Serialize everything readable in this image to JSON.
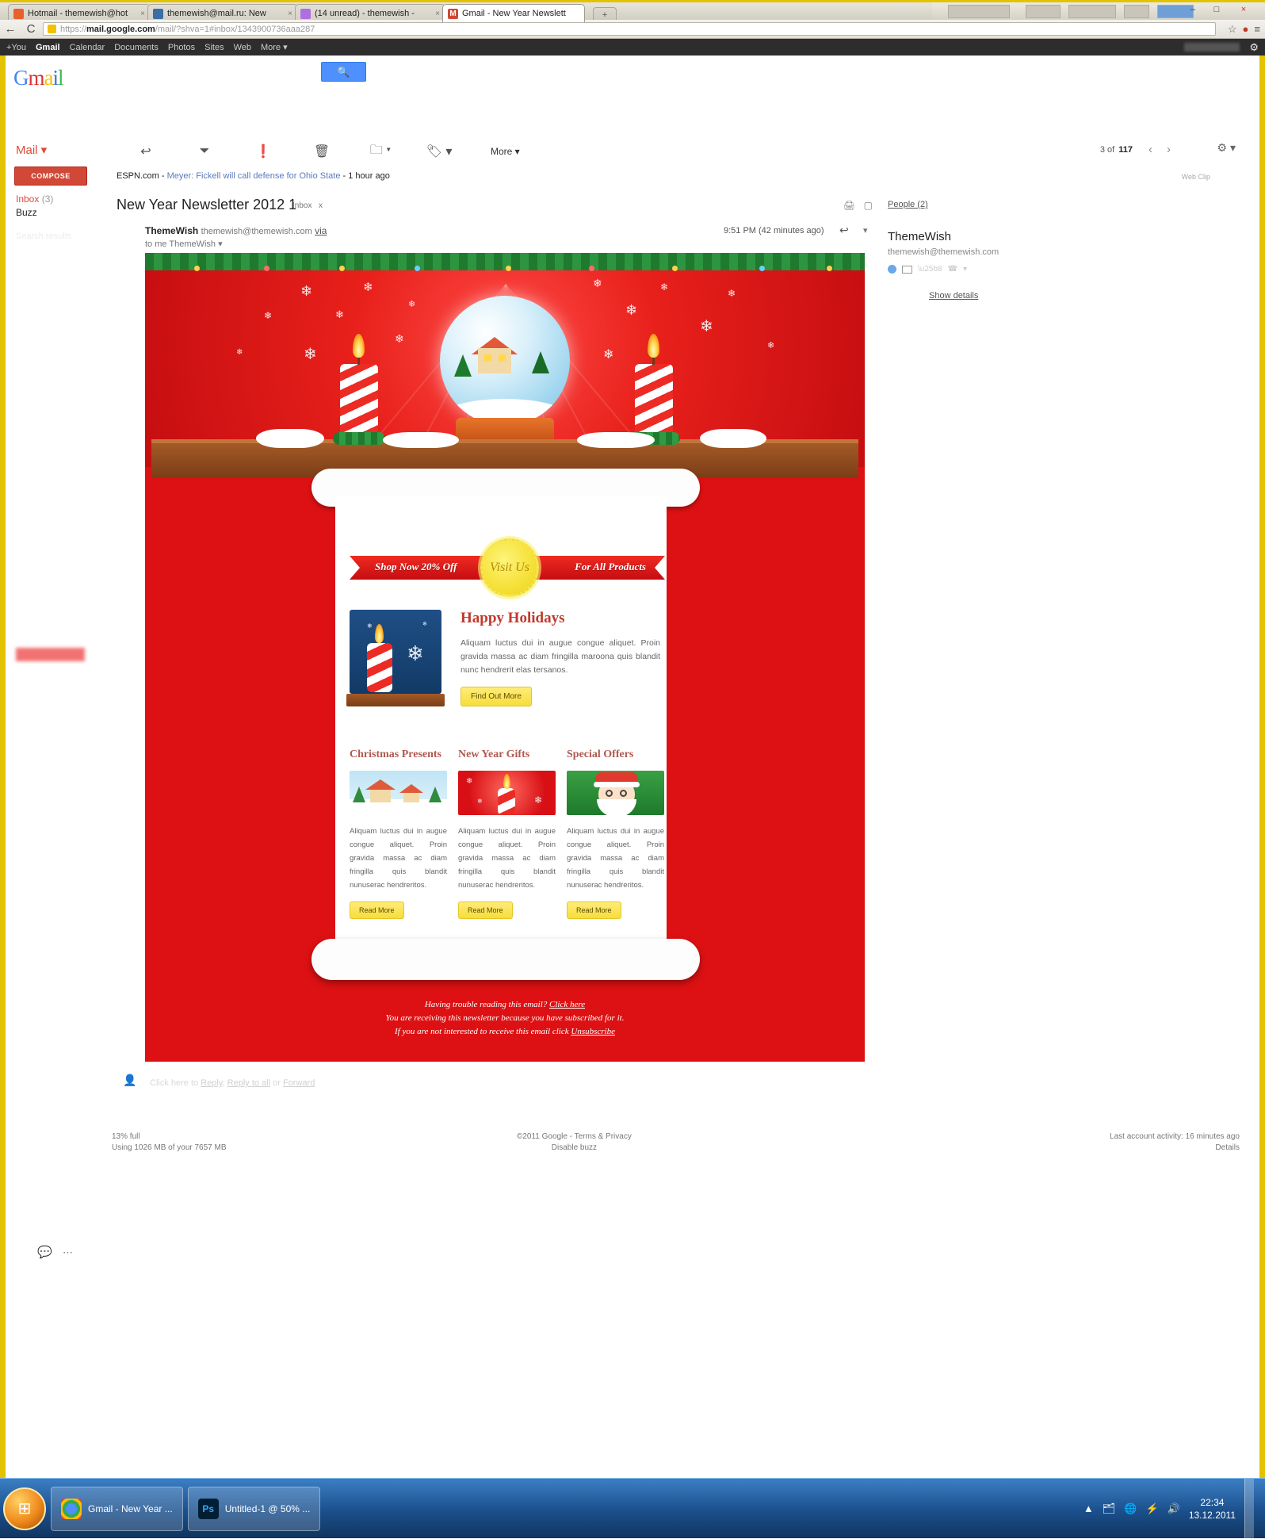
{
  "browser": {
    "tabs": [
      {
        "title": "Hotmail - themewish@hot",
        "favicon": "#e8602c",
        "active": false
      },
      {
        "title": "themewish@mail.ru: New ",
        "favicon": "#3a6ea5",
        "active": false
      },
      {
        "title": "(14 unread) - themewish - ",
        "favicon": "#9b5bd6",
        "active": false
      },
      {
        "title": "Gmail - New Year Newslett",
        "favicon": "#d14836",
        "active": true
      }
    ],
    "new_tab_label": "+",
    "close_label": "×",
    "nav": {
      "back": "←",
      "reload": "C"
    },
    "url_scheme": "https://",
    "url_host": "mail.google.com",
    "url_path": "/mail/?shva=1#inbox/1343900736aaa287",
    "toolbar_right": [
      "☆",
      "●",
      "≡"
    ],
    "window_controls": [
      "–",
      "□",
      "×"
    ]
  },
  "google_bar": {
    "links": [
      "+You",
      "Gmail",
      "Calendar",
      "Documents",
      "Photos",
      "Sites",
      "Web",
      "More ▾"
    ],
    "selected": "Gmail",
    "gear": "⚙"
  },
  "gmail": {
    "logo": {
      "g": "G",
      "m": "m",
      "a": "a",
      "i": "i",
      "l": "l"
    },
    "search_icon": "🔍",
    "mail_dropdown": "Mail ▾",
    "compose_label": "COMPOSE",
    "nav_items": [
      {
        "label": "Inbox",
        "count": "(3)"
      },
      {
        "label": "Buzz",
        "count": ""
      }
    ],
    "search_results_faint": "Search results",
    "toolbar_icons": [
      {
        "name": "back-to-inbox-icon",
        "glyph": "↩"
      },
      {
        "name": "archive-icon",
        "glyph": "⏷"
      },
      {
        "name": "report-spam-icon",
        "glyph": "❗"
      },
      {
        "name": "delete-icon",
        "glyph": "🗑"
      },
      {
        "name": "move-to-icon",
        "glyph": "🗀 ▾"
      },
      {
        "name": "labels-icon",
        "glyph": "🏷 ▾"
      }
    ],
    "more_label": "More ▾",
    "pager": {
      "prefix": "3",
      "of": "of",
      "total": "117",
      "prev": "‹",
      "next": "›"
    },
    "settings_gear": "⚙ ▾",
    "webclip": {
      "source": "ESPN.com",
      "dash": " - ",
      "headline": "Meyer: Fickell will call defense for Ohio State",
      "time": " - 1 hour ago",
      "label": "Web Clip"
    },
    "message": {
      "subject": "New Year Newsletter 2012 1",
      "label_tag": "Inbox",
      "label_x": "x",
      "print_icon": "🖨",
      "popout_icon": "▢",
      "sender_name": "ThemeWish",
      "sender_email": "themewish@themewish.com",
      "via": "via",
      "to_line": "to me",
      "to_name": "ThemeWish",
      "to_caret": "▾",
      "timestamp": "9:51 PM (42 minutes ago)",
      "reply_arrow": "↩",
      "reply_caret": "▾"
    },
    "people_panel": {
      "header": "People (2)",
      "name": "ThemeWish",
      "email": "themewish@themewish.com",
      "show_details": "Show details"
    },
    "reply_area": {
      "prefix": "Click here to",
      "reply": "Reply",
      "comma": ",",
      "reply_all": "Reply to all",
      "or": "or",
      "forward": "Forward"
    },
    "footer": {
      "storage_pct": "13% full",
      "storage_detail": "Using 1026 MB of your 7657 MB",
      "copyright": "©2011 Google - ",
      "terms": "Terms & Privacy",
      "disable_buzz": "Disable buzz",
      "activity": "Last account activity: 16 minutes ago",
      "details": "Details"
    },
    "chat_icon": "💬",
    "chat_dots": "⋯"
  },
  "newsletter": {
    "ribbon": {
      "left_text": "Shop Now 20% Off",
      "seal_text": "Visit Us",
      "right_text": "For All Products"
    },
    "feature": {
      "heading": "Happy Holidays",
      "body": "Aliquam luctus dui in augue congue aliquet. Proin gravida massa ac diam fringilla maroona quis blandit nunc hendrerit elas tersanos.",
      "button": "Find Out More"
    },
    "columns": [
      {
        "heading": "Christmas Presents",
        "body": "Aliquam luctus dui in augue congue aliquet. Proin gravida massa ac diam fringilla quis blandit nunuserac hendreritos.",
        "button": "Read More",
        "image": "snowy-village"
      },
      {
        "heading": "New Year Gifts",
        "body": "Aliquam luctus dui in augue congue aliquet. Proin gravida massa ac diam fringilla quis blandit nunuserac hendreritos.",
        "button": "Read More",
        "image": "red-candle"
      },
      {
        "heading": "Special Offers",
        "body": "Aliquam luctus dui in augue congue aliquet. Proin gravida massa ac diam fringilla quis blandit nunuserac hendreritos.",
        "button": "Read More",
        "image": "santa-green"
      }
    ],
    "footer": {
      "line1_text": "Having trouble reading this email? ",
      "line1_link": "Click here",
      "line2": "You are receiving this newsletter because you have subscribed for it.",
      "line3_text": "If you are not interested to receive this email click ",
      "line3_link": "Unsubscribe"
    },
    "colors": {
      "bg_red": "#dd1113",
      "ribbon_red": "#c60d10",
      "seal_yellow": "#f6e23c",
      "heading_red": "#c0392b"
    }
  },
  "taskbar": {
    "start_glyph": "⊞",
    "items": [
      {
        "label": "Gmail - New Year ...",
        "icon_text": "C",
        "icon_color": "#f5c33b"
      },
      {
        "label": "Untitled-1 @ 50% ...",
        "icon_text": "Ps",
        "icon_color": "#001e36"
      }
    ],
    "tray_icons": [
      "▲",
      "🗂",
      "🌐",
      "⚡",
      "🔊"
    ],
    "clock_time": "22:34",
    "clock_date": "13.12.2011"
  }
}
